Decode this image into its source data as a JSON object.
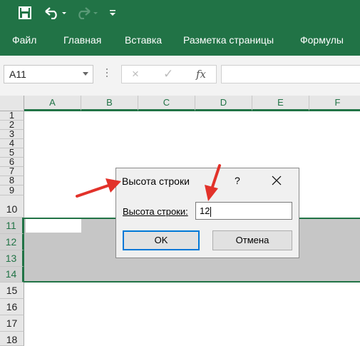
{
  "quick_access": {
    "save_icon": "save-icon",
    "undo_icon": "undo-icon",
    "redo_icon": "redo-icon",
    "customize_icon": "customize-qat-icon"
  },
  "ribbon": {
    "tabs": [
      "Файл",
      "Главная",
      "Вставка",
      "Разметка страницы",
      "Формулы"
    ]
  },
  "formula_bar": {
    "name_box": "A11",
    "cancel_icon": "×",
    "enter_icon": "✓",
    "fx_label": "fx",
    "formula_value": ""
  },
  "sheet": {
    "columns": [
      "A",
      "B",
      "C",
      "D",
      "E",
      "F"
    ],
    "rows": [
      "1",
      "2",
      "3",
      "4",
      "5",
      "6",
      "7",
      "8",
      "9",
      "10",
      "11",
      "12",
      "13",
      "14",
      "15",
      "16",
      "17",
      "18"
    ],
    "selected_rows": [
      "11",
      "12",
      "13",
      "14"
    ]
  },
  "dialog": {
    "title": "Высота строки",
    "help": "?",
    "label": "Высота строки:",
    "value": "12",
    "ok_label": "OK",
    "cancel_label": "Отмена"
  },
  "colors": {
    "excel_green": "#217346",
    "selection_gray": "#c6c6c6",
    "annotation_arrow": "#e2322a"
  }
}
